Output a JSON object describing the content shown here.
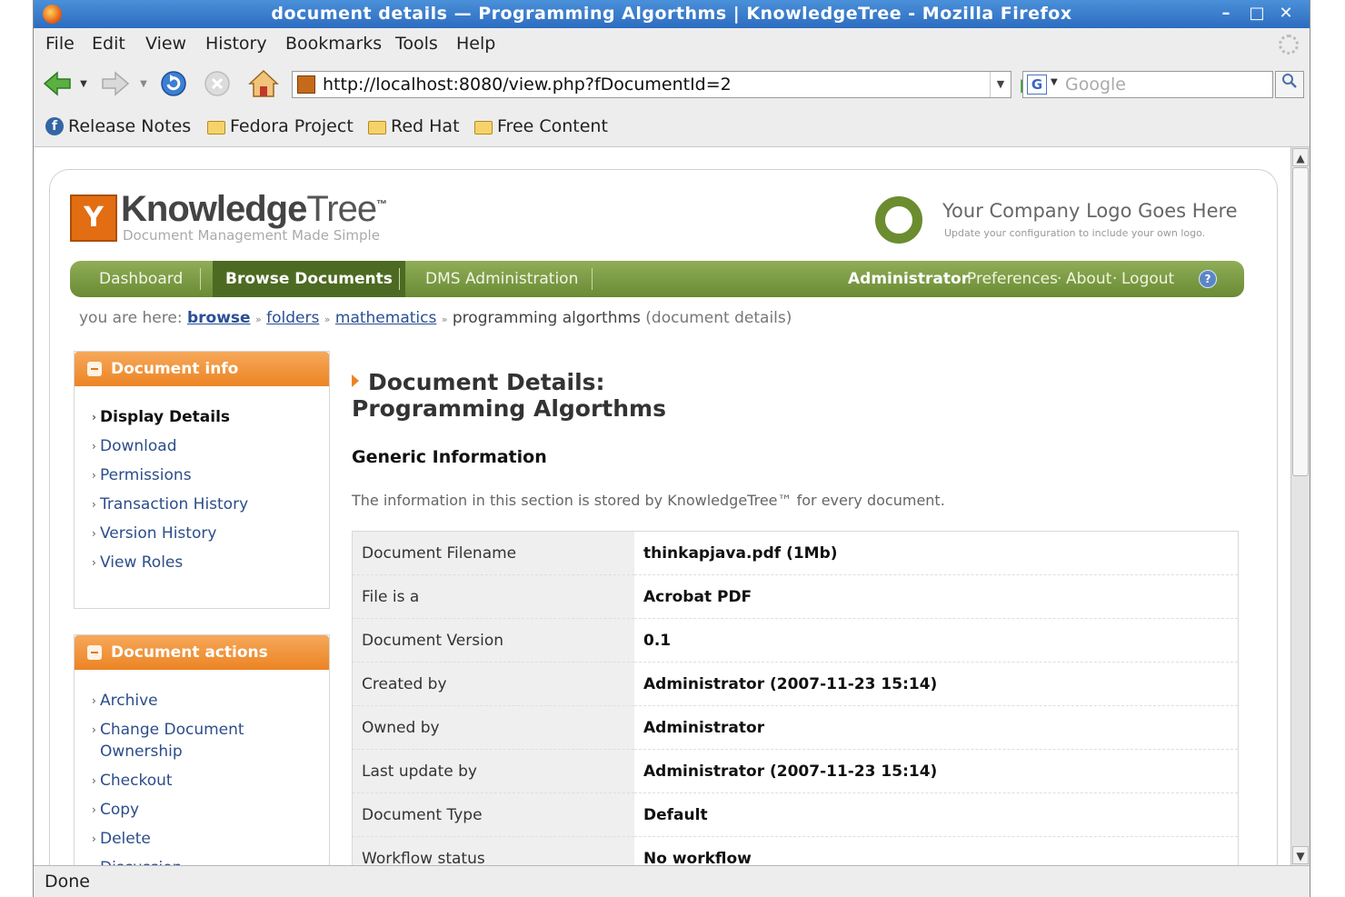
{
  "window": {
    "title": "document details — Programming Algorthms | KnowledgeTree - Mozilla Firefox",
    "controls": [
      "–",
      "□",
      "✕"
    ]
  },
  "menubar": {
    "items": [
      {
        "label": "File"
      },
      {
        "label": "Edit"
      },
      {
        "label": "View"
      },
      {
        "label": "History"
      },
      {
        "label": "Bookmarks"
      },
      {
        "label": "Tools"
      },
      {
        "label": "Help"
      }
    ]
  },
  "navbar": {
    "url": "http://localhost:8080/view.php?fDocumentId=2",
    "search_placeholder": "Google",
    "search_engine": "G"
  },
  "bookmarks": [
    {
      "label": "Release Notes",
      "icon": "release-notes-icon"
    },
    {
      "label": "Fedora Project",
      "icon": "folder-icon"
    },
    {
      "label": "Red Hat",
      "icon": "folder-icon"
    },
    {
      "label": "Free Content",
      "icon": "folder-icon"
    }
  ],
  "header": {
    "logo_name_bold": "Knowledge",
    "logo_name_light": "Tree",
    "logo_tm": "™",
    "logo_tagline": "Document Management Made Simple",
    "company_logo_text": "Your Company Logo Goes Here",
    "company_logo_sub": "Update your configuration to include your own logo."
  },
  "nav": {
    "tabs": [
      {
        "label": "Dashboard"
      },
      {
        "label": "Browse Documents"
      },
      {
        "label": "DMS Administration"
      }
    ],
    "user": "Administrator",
    "links": [
      "Preferences",
      "About",
      "Logout"
    ],
    "dot": "·",
    "help": "?"
  },
  "breadcrumb": {
    "prefix": "you are here:",
    "links": [
      "browse",
      "folders",
      "mathematics"
    ],
    "current": "programming algorthms",
    "suffix": "(document details)",
    "sep": "»"
  },
  "sidebar": {
    "info_panel": {
      "title": "Document info",
      "items": [
        "Display Details",
        "Download",
        "Permissions",
        "Transaction History",
        "Version History",
        "View Roles"
      ]
    },
    "actions_panel": {
      "title": "Document actions",
      "items": [
        "Archive",
        "Change Document Ownership",
        "Checkout",
        "Copy",
        "Delete",
        "Discussion"
      ]
    }
  },
  "main": {
    "title_line1": "Document Details:",
    "title_line2": "Programming Algorthms",
    "section": "Generic Information",
    "description": "The information in this section is stored by KnowledgeTree™ for every document.",
    "rows": [
      {
        "key": "Document Filename",
        "value": "thinkapjava.pdf (1Mb)"
      },
      {
        "key": "File is a",
        "value": "Acrobat PDF"
      },
      {
        "key": "Document Version",
        "value": "0.1"
      },
      {
        "key": "Created by",
        "value": "Administrator (2007-11-23 15:14)"
      },
      {
        "key": "Owned by",
        "value": "Administrator"
      },
      {
        "key": "Last update by",
        "value": "Administrator (2007-11-23 15:14)"
      },
      {
        "key": "Document Type",
        "value": "Default"
      },
      {
        "key": "Workflow status",
        "value": "No workflow"
      }
    ]
  },
  "statusbar": {
    "text": "Done"
  }
}
